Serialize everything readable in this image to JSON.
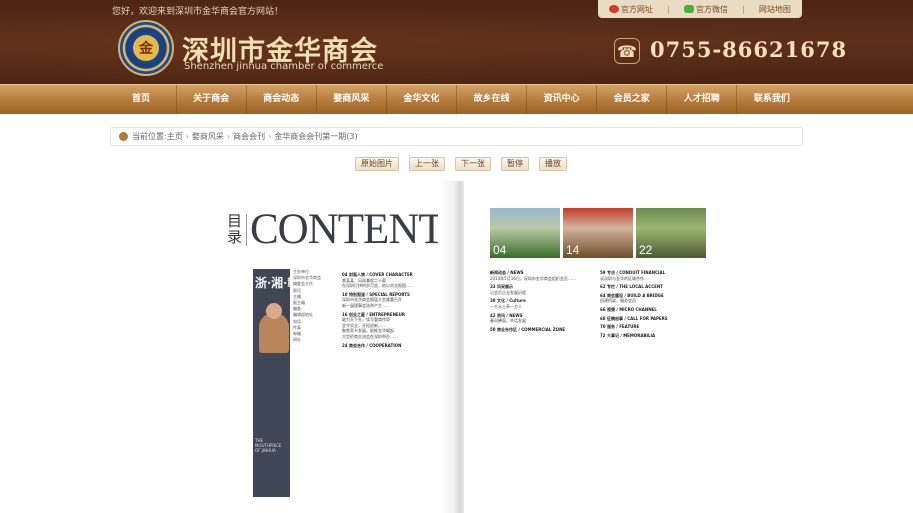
{
  "header": {
    "welcome": "您好，欢迎来到深圳市金华商会官方网站！",
    "links": [
      "官方网址",
      "官方微信",
      "网站地图"
    ],
    "brand_cn": "深圳市金华商会",
    "brand_en": "Shenzhen jinhua chamber of commerce",
    "logo_glyph": "金",
    "phone": "0755-86621678"
  },
  "nav": [
    "首页",
    "关于商会",
    "商会动态",
    "婺商风采",
    "金华文化",
    "故乡在线",
    "资讯中心",
    "会员之家",
    "人才招聘",
    "联系我们"
  ],
  "breadcrumb": {
    "prefix": "当前位置:",
    "items": [
      "主页",
      "婺商风采",
      "商会会刊",
      "金华商会会刊第一期(3)"
    ],
    "sep": "›"
  },
  "controls": [
    "原始图片",
    "上一张",
    "下一张",
    "暂停",
    "播放"
  ],
  "magazine": {
    "left": {
      "mulu": "目录",
      "contents": "CONTENTS",
      "cover_title": "浙·湘·赣·粤",
      "cover_caption": "THE MOUTHPIECE OF JINHUA",
      "masthead": [
        "主办单位",
        "深圳市金华商会",
        "编委会主任",
        "顾问",
        "主编",
        "副主编",
        "编委",
        "编辑部地址",
        "电话",
        "传真",
        "邮编",
        "网址"
      ],
      "toc1": [
        {
          "h": "04 封面人物 / COVER CHARACTER"
        },
        {
          "t": "曾某某：风雨兼程二十载"
        },
        {
          "t": "在深圳打拼的岁月里，他以实业报国……"
        },
        {
          "h": "10 特别报道 / SPECIAL REPORTS"
        },
        {
          "t": "深圳市金华商会换届大会隆重召开"
        },
        {
          "t": "新一届理事会选举产生……"
        },
        {
          "h": "16 创业之星 / ENTREPRENEUR"
        },
        {
          "t": "敢为天下先，续写婺商传奇"
        },
        {
          "t": "坚守实业，开拓创新……"
        },
        {
          "t": "聚焦家乡发展，助推金华崛起"
        },
        {
          "t": "大型侨商交流会在深圳举办……"
        },
        {
          "h": "24 商会合作 / COOPERATION"
        }
      ]
    },
    "right": {
      "photos": [
        "04",
        "14",
        "22"
      ],
      "col1": [
        {
          "h": "新闻动态 / NEWS"
        },
        {
          "t": "2013年5月16日，深圳市金华商会组织会员……"
        },
        {
          "h": "33 风采展示"
        },
        {
          "t": "记会员企业发展历程"
        },
        {
          "h": "38 文化 / Culture"
        },
        {
          "t": "一方水土养一方人"
        },
        {
          "h": "42 资讯 / NEWS"
        },
        {
          "t": "春风拂面，共话发展"
        },
        {
          "h": "50 商业合作区 / COMMERCIAL ZONE"
        }
      ],
      "col2": [
        {
          "h": "59 专访 / CONDUIT FINANCIAL"
        },
        {
          "t": "谈深圳与金华的区域合作"
        },
        {
          "h": "62 专栏 / THE LOCAL ACCENT"
        },
        {
          "h": "64 商会建设 / BUILD A BRIDGE"
        },
        {
          "t": "搭建桥梁，服务会员"
        },
        {
          "h": "66 视频 / MICRO CHANNEL"
        },
        {
          "h": "68 征稿启事 / CALL FOR PAPERS"
        },
        {
          "h": "70 服务 / FEATURE"
        },
        {
          "h": "72 大事记 / MEMORABILIA"
        }
      ]
    }
  }
}
